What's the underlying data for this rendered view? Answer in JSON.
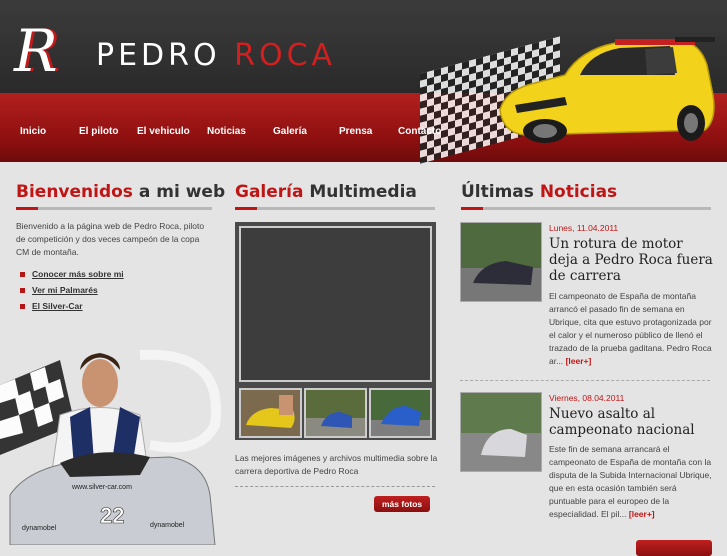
{
  "brand": {
    "initial": "R",
    "name_part1": "PEDRO ",
    "name_part2": "ROCA"
  },
  "nav": [
    "Inicio",
    "El piloto",
    "El vehiculo",
    "Noticias",
    "Galería",
    "Prensa",
    "Contacto"
  ],
  "welcome": {
    "title_red": "Bienvenidos",
    "title_rest": " a mi web",
    "text": "Bienvenido a la página web de Pedro Roca, piloto de competición y dos veces campeón de la copa CM de montaña.",
    "links": [
      "Conocer más sobre mi",
      "Ver mi Palmarés",
      "El Silver-Car"
    ]
  },
  "gallery": {
    "title_red": "Galería",
    "title_rest": " Multimedia",
    "text": "Las mejores imágenes y archivos multimedia sobre la carrera deportiva de Pedro Roca",
    "button": "más fotos"
  },
  "news": {
    "title_rest": "Últimas ",
    "title_red": "Noticias",
    "items": [
      {
        "date": "Lunes, 11.04.2011",
        "title": "Un rotura de motor deja a Pedro Roca fuera de carrera",
        "body": "El campeonato de España de montaña arrancó el pasado fin de semana en Ubrique, cita que estuvo protagonizada por el calor y el numeroso público de llenó el trazado de la prueba gaditana. Pedro Roca ar...",
        "more": "[leer+]"
      },
      {
        "date": "Viernes, 08.04.2011",
        "title": "Nuevo asalto al campeonato nacional",
        "body": "Este fin de semana arrancará el campeonato de España de montaña con la disputa de la Subida Internacional Ubrique, que en esta ocasión también será puntuable para el europeo de la especialidad. El pil...",
        "more": "[leer+]"
      }
    ]
  },
  "car_banner": {
    "url_text": "www.silver-car.com",
    "brand_text": "dynamobel",
    "number": "22"
  },
  "colors": {
    "accent": "#c01515",
    "header": "#2f2f2f",
    "background": "#e4e4e4"
  }
}
